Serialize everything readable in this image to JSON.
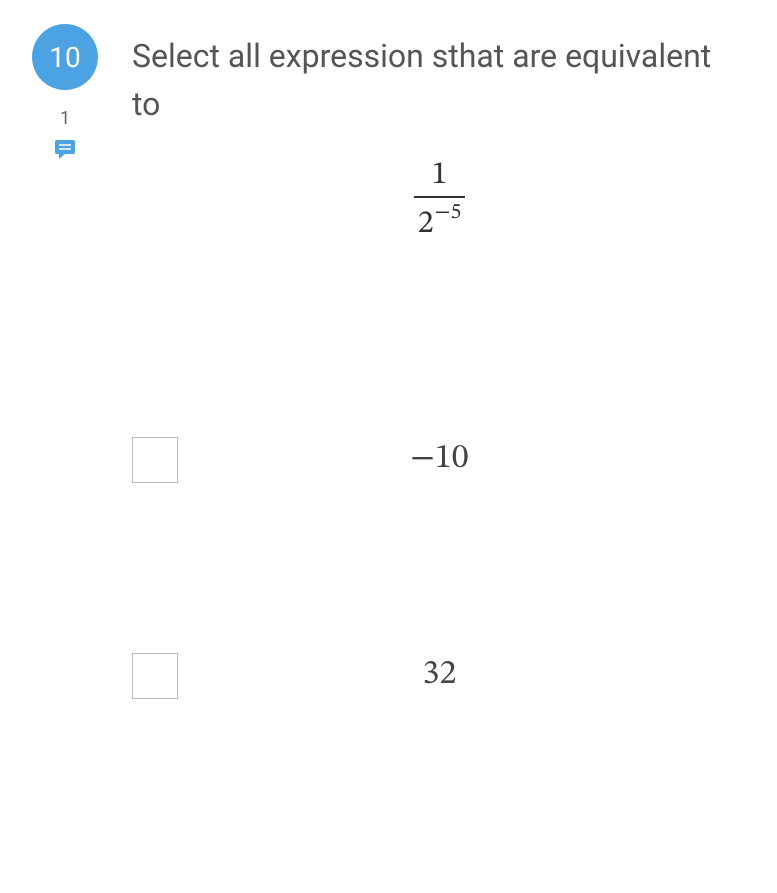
{
  "question": {
    "number": "10",
    "comment_count": "1",
    "prompt": "Select all expression sthat are equivalent to"
  },
  "expression": {
    "numerator": "1",
    "denominator_base": "2",
    "denominator_exponent": "−5"
  },
  "options": [
    {
      "label": "−10"
    },
    {
      "label": "32"
    }
  ],
  "colors": {
    "badge_bg": "#4ba3e3",
    "icon_bg": "#4ba3e3"
  }
}
